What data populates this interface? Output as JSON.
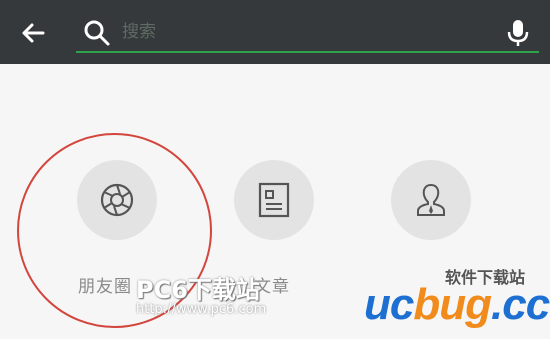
{
  "search": {
    "placeholder": "搜索"
  },
  "categories": [
    {
      "label": "朋友圈",
      "icon": "aperture-icon"
    },
    {
      "label": "文章",
      "icon": "article-icon"
    },
    {
      "label": "",
      "icon": "contact-icon"
    }
  ],
  "watermarks": {
    "pc6": "PC6下载站",
    "pc6_url": "http://www.pc6.com",
    "ucbug_sub": "软件下载站",
    "ucbug_logo_a": "uc",
    "ucbug_logo_b": "bug",
    "ucbug_logo_c": ".cc"
  },
  "colors": {
    "topbar": "#35393c",
    "accent_green": "#2fa34c",
    "highlight_ring": "#d2463e"
  }
}
